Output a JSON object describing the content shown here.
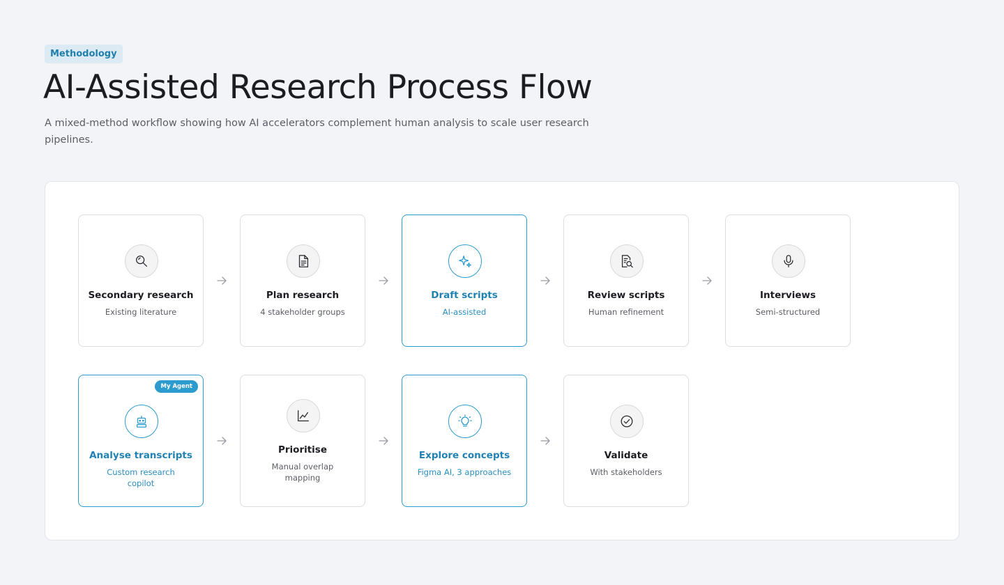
{
  "header": {
    "tag": "Methodology",
    "title": "AI-Assisted Research Process Flow",
    "subtitle": "A mixed-method workflow showing how AI accelerators complement human analysis to scale user research pipelines."
  },
  "colors": {
    "accent": "#2c9ccf",
    "accent_text": "#1f82b3",
    "tag_bg": "#dcebf3"
  },
  "steps": [
    {
      "label": "Secondary research",
      "sub": "Existing literature",
      "icon": "search-icon",
      "ai": false
    },
    {
      "label": "Plan research",
      "sub": "4 stakeholder groups",
      "icon": "document-icon",
      "ai": false
    },
    {
      "label": "Draft scripts",
      "sub": "AI-assisted",
      "icon": "sparkle-icon",
      "ai": true
    },
    {
      "label": "Review scripts",
      "sub": "Human refinement",
      "icon": "document-search-icon",
      "ai": false
    },
    {
      "label": "Interviews",
      "sub": "Semi-structured",
      "icon": "microphone-icon",
      "ai": false
    },
    {
      "label": "Analyse transcripts",
      "sub": "Custom research copilot",
      "icon": "robot-icon",
      "ai": true,
      "badge": "My Agent"
    },
    {
      "label": "Prioritise",
      "sub": "Manual overlap mapping",
      "icon": "chart-line-icon",
      "ai": false
    },
    {
      "label": "Explore concepts",
      "sub": "Figma AI, 3 approaches",
      "icon": "lightbulb-icon",
      "ai": true
    },
    {
      "label": "Validate",
      "sub": "With stakeholders",
      "icon": "check-circle-icon",
      "ai": false
    }
  ]
}
